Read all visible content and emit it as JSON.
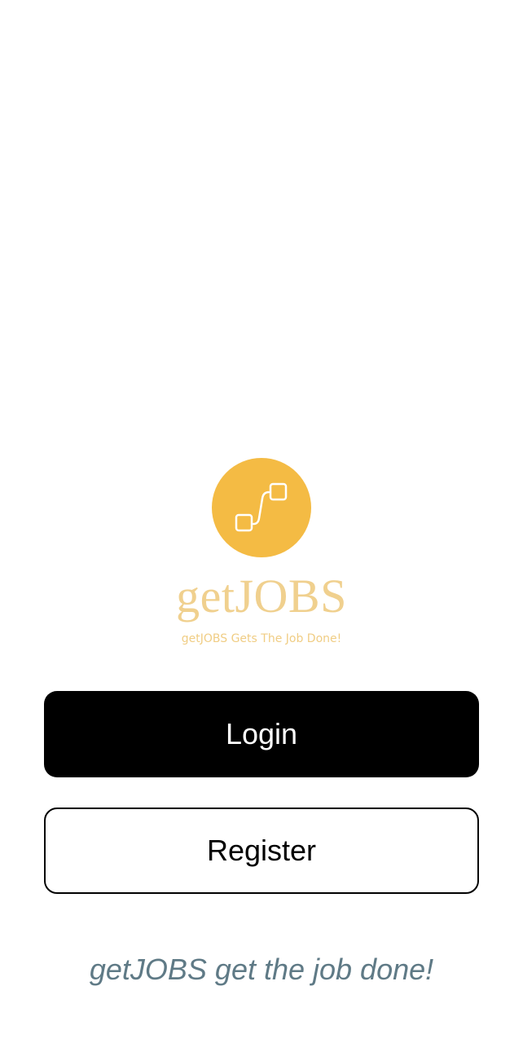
{
  "brand": {
    "name": "getJOBS",
    "tagline": "getJOBS Gets The Job Done!",
    "logo_icon": "connected-squares-icon",
    "logo_color": "#F4BB44",
    "wordmark_color": "#F0D08E"
  },
  "actions": {
    "login_label": "Login",
    "register_label": "Register"
  },
  "footer": {
    "slogan": "getJOBS get the job done!",
    "slogan_color": "#5F7A86"
  }
}
